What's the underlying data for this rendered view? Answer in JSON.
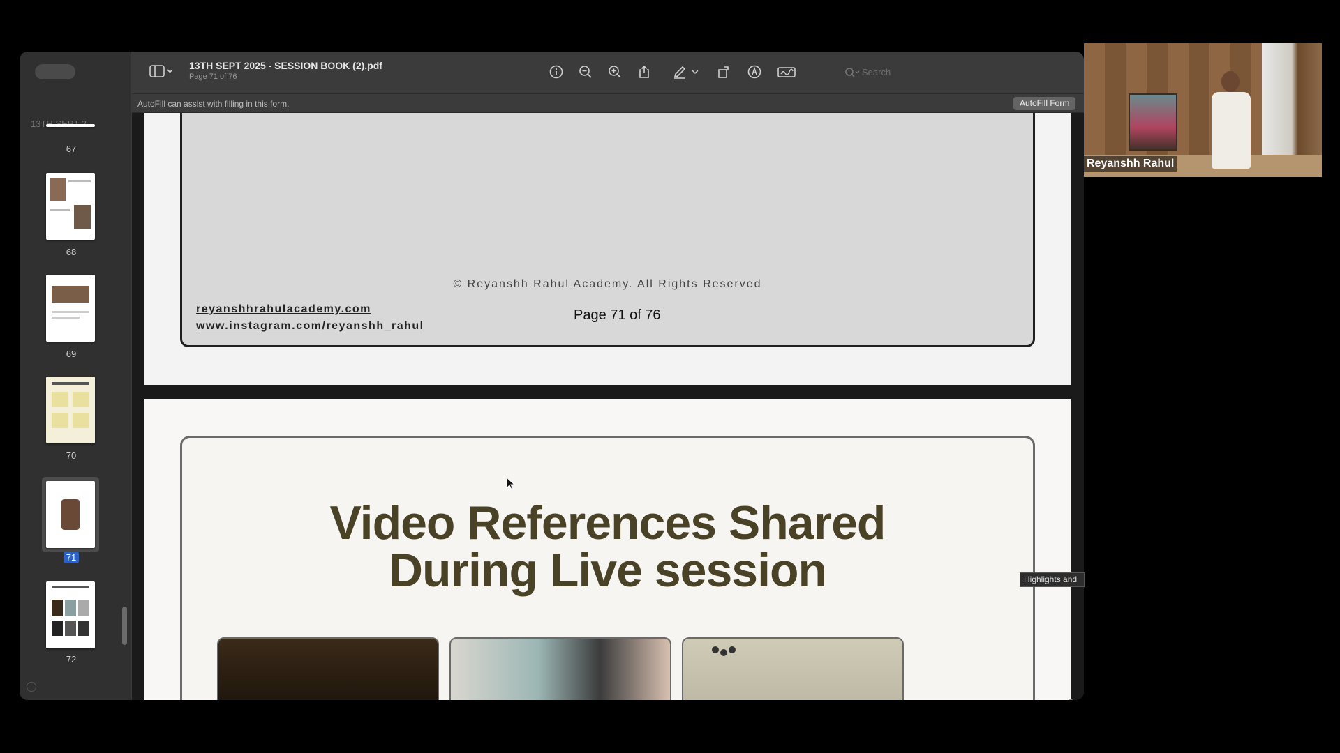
{
  "toolbar": {
    "title": "13TH SEPT 2025 - SESSION BOOK (2).pdf",
    "subtitle": "Page 71 of 76",
    "search_placeholder": "Search",
    "icons": [
      "sidebar-toggle-icon",
      "info-icon",
      "zoom-out-icon",
      "zoom-in-icon",
      "share-icon",
      "markup-pen-icon",
      "rotate-icon",
      "annotate-icon",
      "signature-icon",
      "search-icon"
    ]
  },
  "autofill": {
    "message": "AutoFill can assist with filling in this form.",
    "button_label": "AutoFill Form"
  },
  "sidebar": {
    "title": "13TH SEPT 2...",
    "thumbnails": [
      {
        "page": "67"
      },
      {
        "page": "68"
      },
      {
        "page": "69"
      },
      {
        "page": "70"
      },
      {
        "page": "71",
        "selected": true
      },
      {
        "page": "72"
      }
    ]
  },
  "page_71": {
    "copyright": "© Reyanshh Rahul Academy. All Rights Reserved",
    "link_website": "reyanshhrahulacademy.com",
    "link_instagram": "www.instagram.com/reyanshh_rahul",
    "page_label": "Page 71 of 76"
  },
  "page_72": {
    "heading_line1": "Video References Shared",
    "heading_line2": "During Live session"
  },
  "tooltip": "Highlights and",
  "webcam": {
    "participant_name": "Reyanshh Rahul"
  }
}
